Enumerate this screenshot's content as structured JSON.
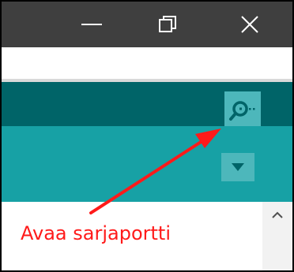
{
  "titlebar": {
    "minimize_icon": "minimize-icon",
    "maximize_icon": "restore-icon",
    "close_icon": "close-icon"
  },
  "toolbar": {
    "serial_monitor_icon": "serial-monitor-icon"
  },
  "tabsbar": {
    "tab_menu_icon": "chevron-down-icon"
  },
  "editor": {
    "scroll_up_icon": "chevron-up-icon"
  },
  "annotation": {
    "text": "Avaa sarjaportti",
    "color": "#ff1a1a"
  },
  "colors": {
    "titlebar": "#3f3f3f",
    "toolbar": "#006468",
    "tabsbar": "#17a1a5",
    "button_highlight": "#4db7bb"
  }
}
